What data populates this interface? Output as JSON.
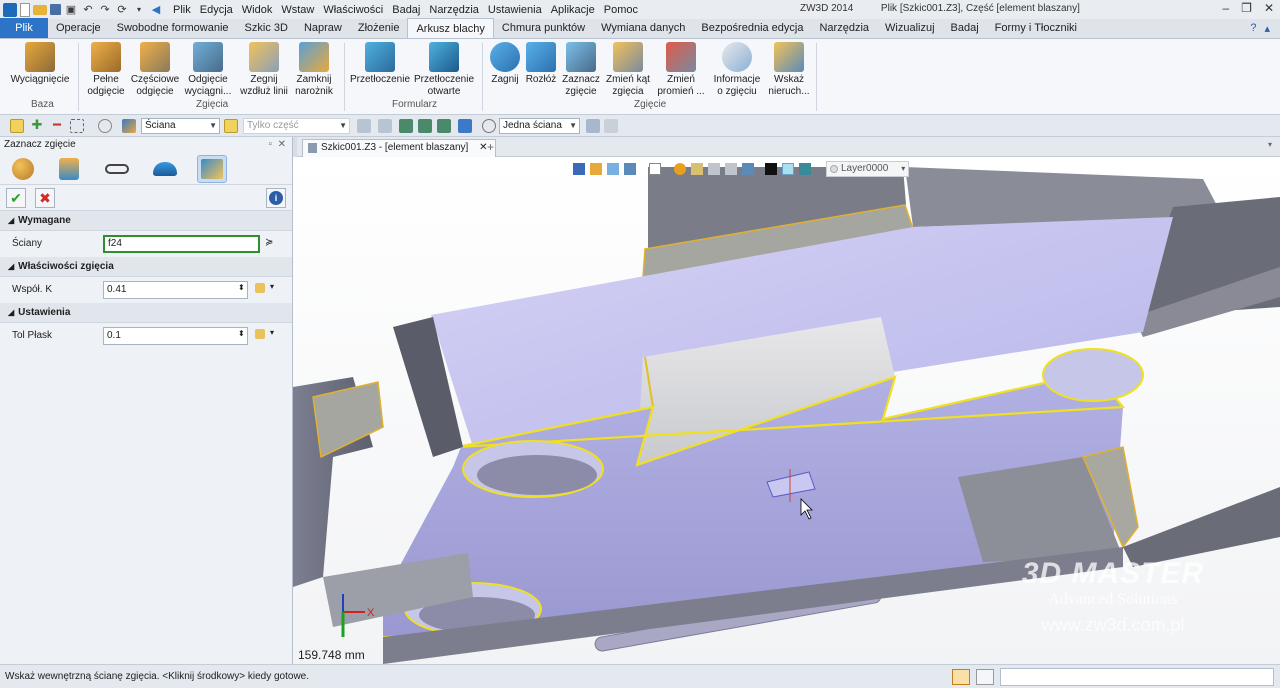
{
  "title_bar": {
    "menus": [
      "Plik",
      "Edycja",
      "Widok",
      "Wstaw",
      "Właściwości",
      "Badaj",
      "Narzędzia",
      "Ustawienia",
      "Aplikacje",
      "Pomoc"
    ],
    "app_name": "ZW3D 2014",
    "file_info": "Plik [Szkic001.Z3],  Część [element blaszany]"
  },
  "ribbon_tabs": [
    "Plik",
    "Operacje",
    "Swobodne formowanie",
    "Szkic 3D",
    "Napraw",
    "Złożenie",
    "Arkusz blachy",
    "Chmura punktów",
    "Wymiana danych",
    "Bezpośrednia edycja",
    "Narzędzia",
    "Wizualizuj",
    "Badaj",
    "Formy i Tłoczniki"
  ],
  "ribbon": {
    "groups": [
      "Baza",
      "Zgięcia",
      "Formularz",
      "Zgięcie"
    ],
    "buttons": [
      [
        "Wyciągnięcie",
        ""
      ],
      [
        "Pełne",
        "odgięcie"
      ],
      [
        "Częściowe",
        "odgięcie"
      ],
      [
        "Odgięcie",
        "wyciągni..."
      ],
      [
        "Zegnij",
        "wzdłuż linii"
      ],
      [
        "Zamknij",
        "narożnik"
      ],
      [
        "Przetłoczenie",
        ""
      ],
      [
        "Przetłoczenie",
        "otwarte"
      ],
      [
        "Zagnij",
        ""
      ],
      [
        "Rozłóż",
        ""
      ],
      [
        "Zaznacz",
        "zgięcie"
      ],
      [
        "Zmień kąt",
        "zgięcia"
      ],
      [
        "Zmień",
        "promień ..."
      ],
      [
        "Informacje",
        "o zgięciu"
      ],
      [
        "Wskaż",
        "nieruch..."
      ]
    ]
  },
  "toolbar": {
    "filter": "Ściana",
    "only_part": "Tylko część",
    "selection_mode": "Jedna ściana"
  },
  "panel": {
    "title": "Zaznacz zgięcie",
    "sections": {
      "required": "Wymagane",
      "bend_props": "Właściwości zgięcia",
      "settings": "Ustawienia"
    },
    "fields": {
      "faces_label": "Ściany",
      "faces_value": "f24",
      "k_label": "Współ. K",
      "k_value": "0.41",
      "tol_label": "Tol Płask",
      "tol_value": "0.1"
    }
  },
  "document_tab": "Szkic001.Z3 - [element blaszany]",
  "viewport": {
    "layer": "Layer0000",
    "distance": "159.748 mm",
    "watermark": [
      "3D MASTER",
      "Advanced Solutions",
      "www.zw3d.com.pl"
    ]
  },
  "status_bar": {
    "prompt": "Wskaż wewnętrzną ścianę zgięcia.  <Kliknij środkowy> kiedy gotowe."
  }
}
